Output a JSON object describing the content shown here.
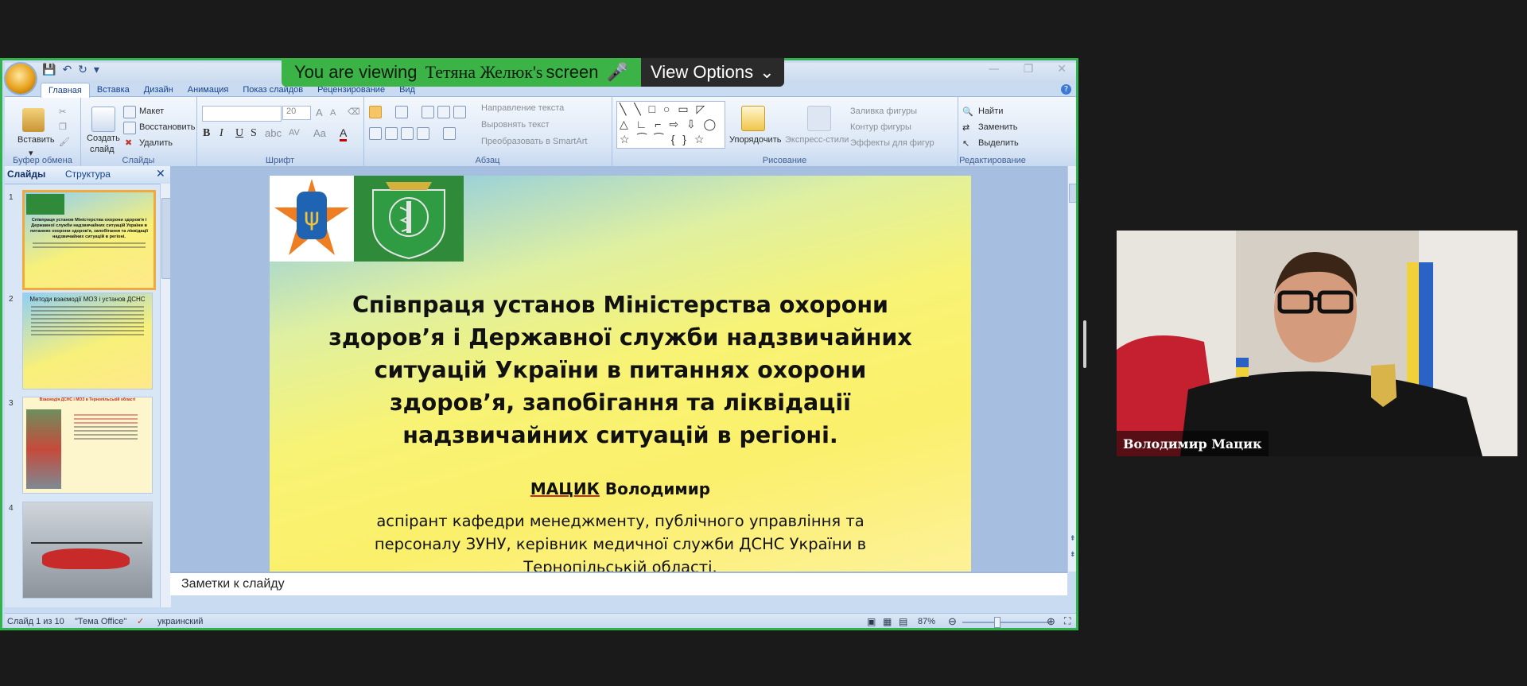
{
  "banner": {
    "viewing_prefix": "You are viewing",
    "presenter": "Тетяна Желюк's",
    "viewing_suffix": "screen",
    "view_options": "View Options"
  },
  "ribbon": {
    "tabs": [
      "Главная",
      "Вставка",
      "Дизайн",
      "Анимация",
      "Показ слайдов",
      "Рецензирование",
      "Вид"
    ],
    "clipboard": {
      "paste": "Вставить",
      "label": "Буфер обмена"
    },
    "slides": {
      "new_slide": "Создать",
      "new_slide2": "слайд",
      "layout": "Макет",
      "reset": "Восстановить",
      "delete": "Удалить",
      "label": "Слайды"
    },
    "font": {
      "size": "20",
      "label": "Шрифт"
    },
    "paragraph": {
      "text_direction": "Направление текста",
      "align_text": "Выровнять текст",
      "smartart": "Преобразовать в SmartArt",
      "label": "Абзац"
    },
    "drawing": {
      "arrange": "Упорядочить",
      "quick_styles": "Экспресс-стили",
      "shape_fill": "Заливка фигуры",
      "shape_outline": "Контур фигуры",
      "shape_effects": "Эффекты для фигур",
      "label": "Рисование"
    },
    "editing": {
      "find": "Найти",
      "replace": "Заменить",
      "select": "Выделить",
      "label": "Редактирование"
    }
  },
  "pane": {
    "tab_slides": "Слайды",
    "tab_outline": "Структура",
    "thumbs": [
      {
        "num": "1",
        "title": "Співпраця установ Міністерства охорони здоров'я і Державної служби надзвичайних ситуацій України в питаннях охорони здоров'я, запобігання та ліквідації надзвичайних ситуацій в регіоні."
      },
      {
        "num": "2",
        "title": "Методи взаємодії МОЗ і установ ДСНС"
      },
      {
        "num": "3",
        "title": "Взаємодія ДСНС і МОЗ в Тернопільській області"
      },
      {
        "num": "4",
        "title": ""
      }
    ]
  },
  "slide": {
    "title": "Співпраця установ Міністерства охорони здоров’я і Державної служби надзвичайних ситуацій України в питаннях охорони здоров’я, запобігання та ліквідації надзвичайних ситуацій в регіоні.",
    "author_last": "МАЦИК",
    "author_first": "Володимир",
    "description": "аспірант кафедри менеджменту, публічного управління та персоналу ЗУНУ, керівник медичної служби ДСНС України в Тернопільській області."
  },
  "notes_placeholder": "Заметки к слайду",
  "status": {
    "slide_count": "Слайд 1 из 10",
    "theme": "\"Тема Office\"",
    "language": "украинский",
    "zoom": "87%"
  },
  "webcam": {
    "name": "Володимир Мацик"
  },
  "colors": {
    "share_border": "#2fb34a",
    "banner_green": "#3cb346"
  }
}
